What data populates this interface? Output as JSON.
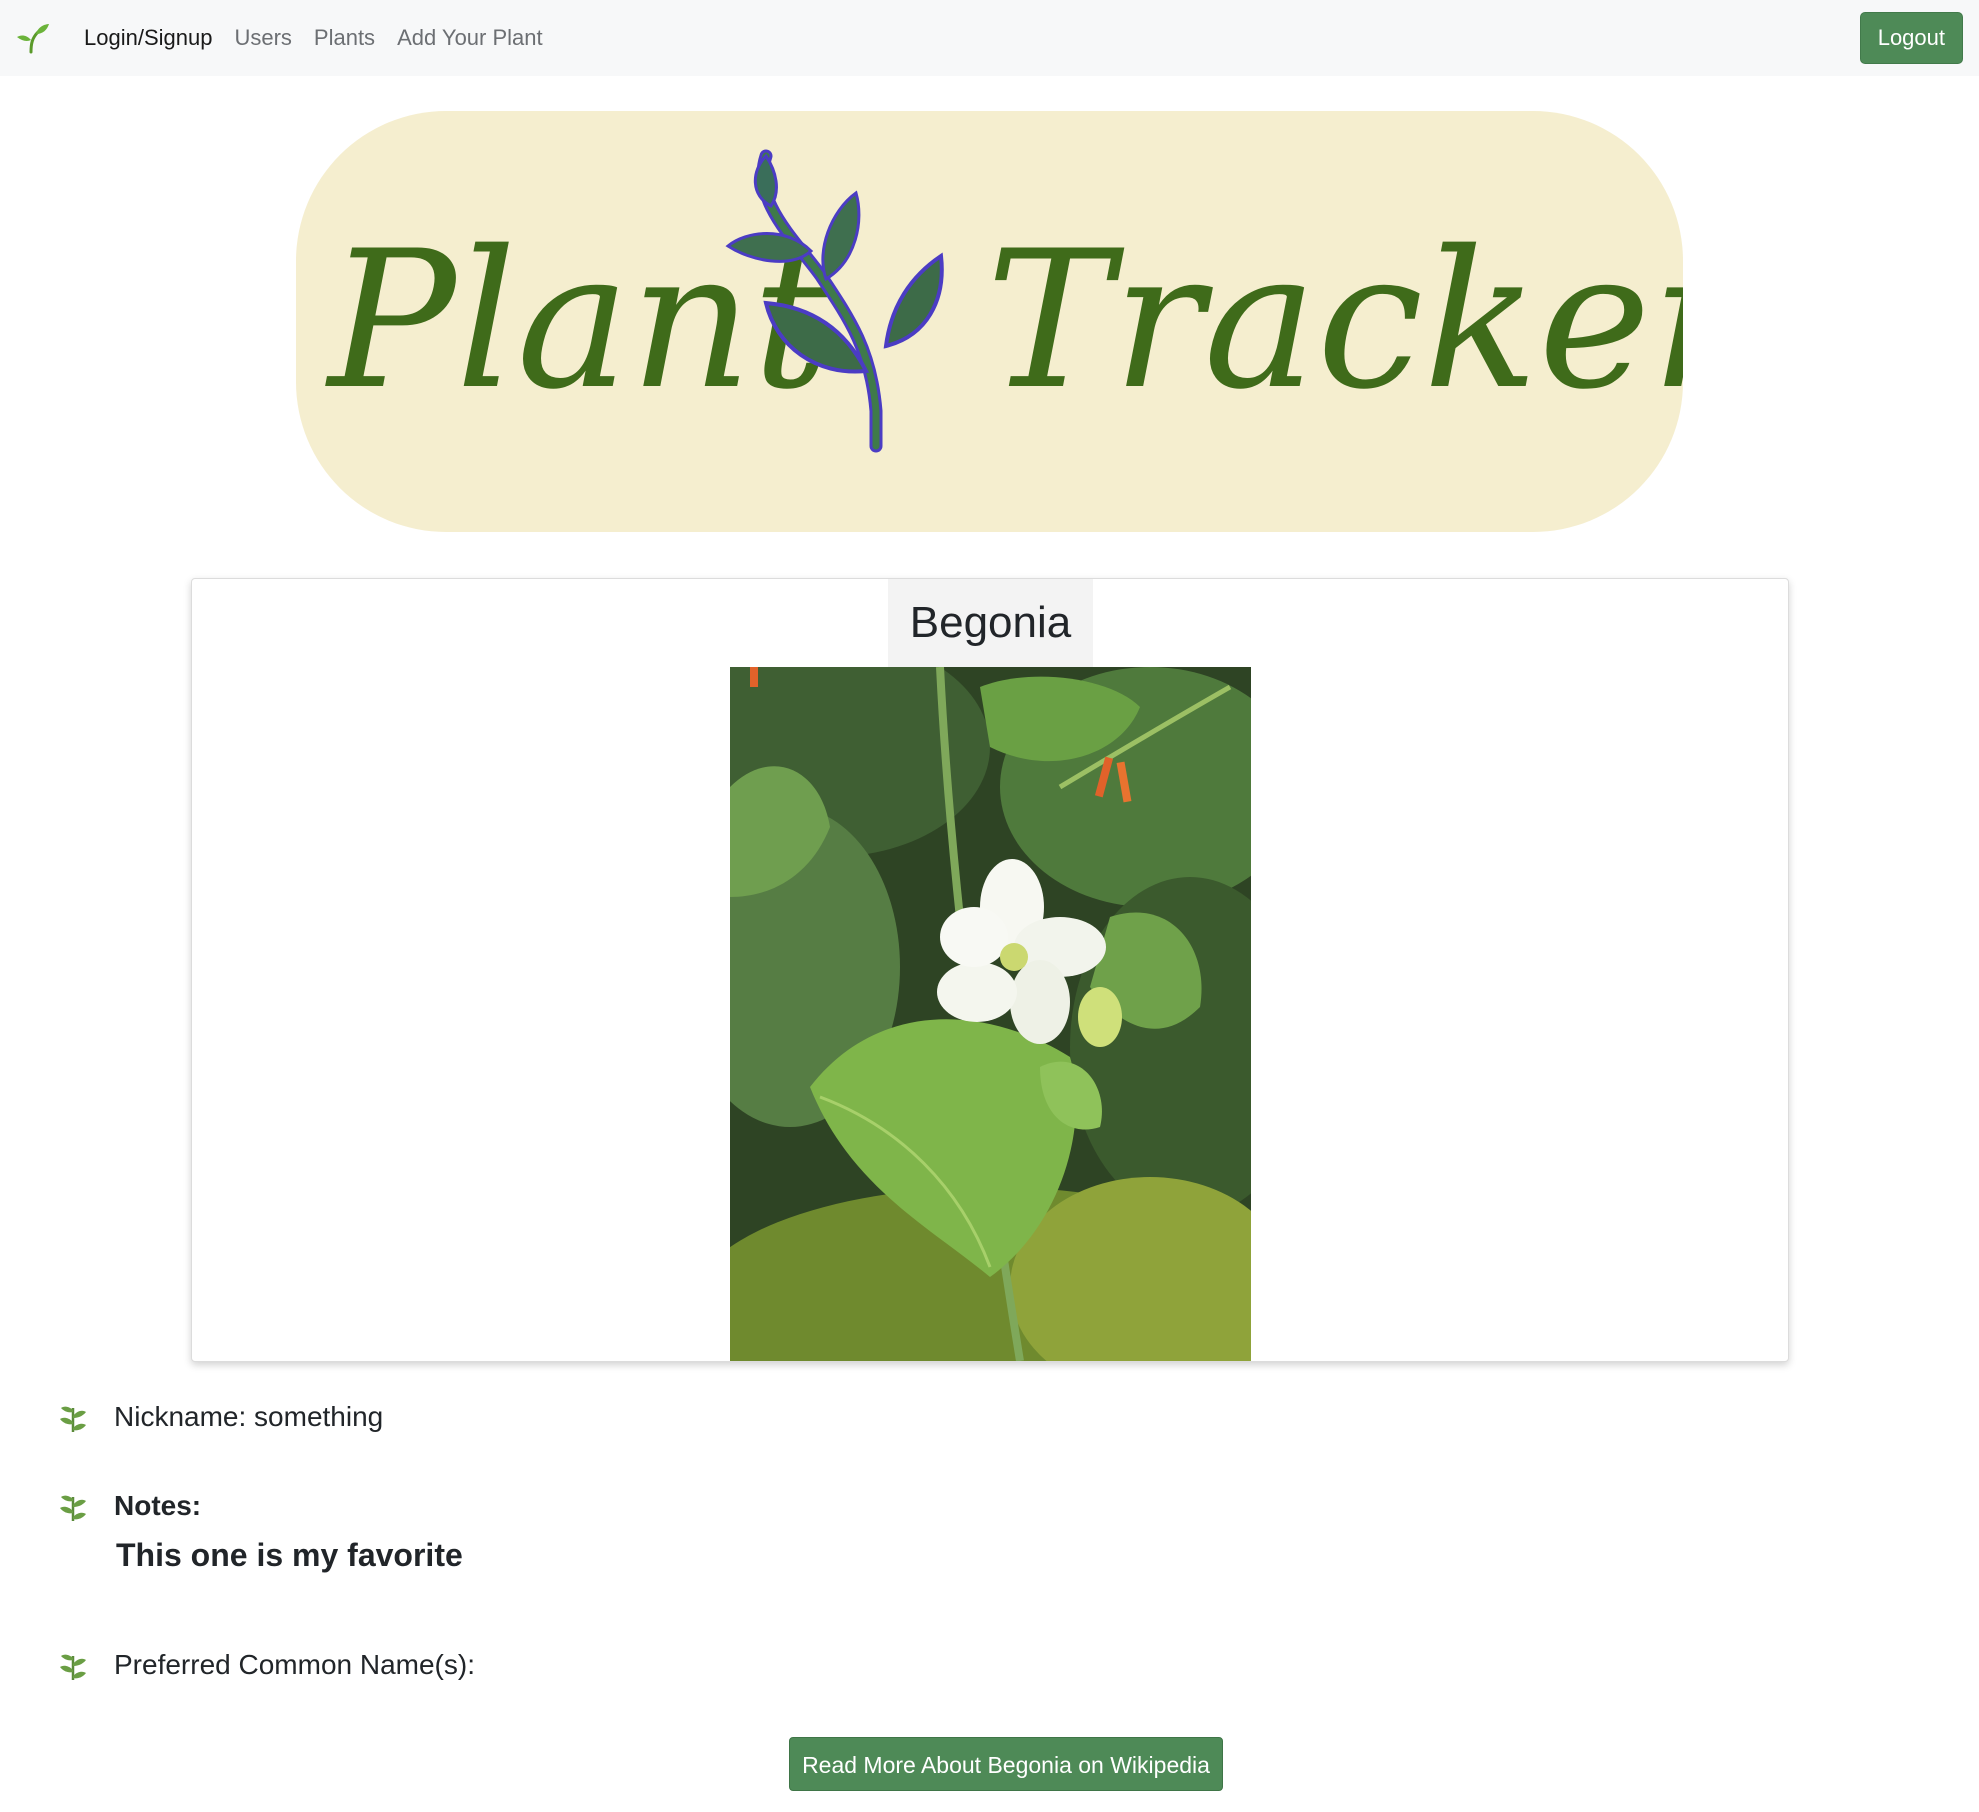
{
  "navbar": {
    "brand_icon": "sprout-icon",
    "links": [
      {
        "label": "Login/Signup",
        "active": true
      },
      {
        "label": "Users",
        "active": false
      },
      {
        "label": "Plants",
        "active": false
      },
      {
        "label": "Add Your Plant",
        "active": false
      }
    ],
    "logout_label": "Logout"
  },
  "logo": {
    "text_left": "Plant",
    "text_right": "Tracker",
    "background": "#f5eecf",
    "text_color": "#3f6b1a"
  },
  "plant": {
    "name": "Begonia",
    "photo_icon": "plant-photo-image",
    "nickname_text": "Nickname: something",
    "notes_label": "Notes:",
    "notes_value": "This one is my favorite",
    "common_name_label": "Preferred Common Name(s):",
    "wiki_button_label": "Read More About Begonia on Wikipedia"
  },
  "colors": {
    "accent": "#4e8a57",
    "navbar_bg": "#f7f8f9"
  }
}
